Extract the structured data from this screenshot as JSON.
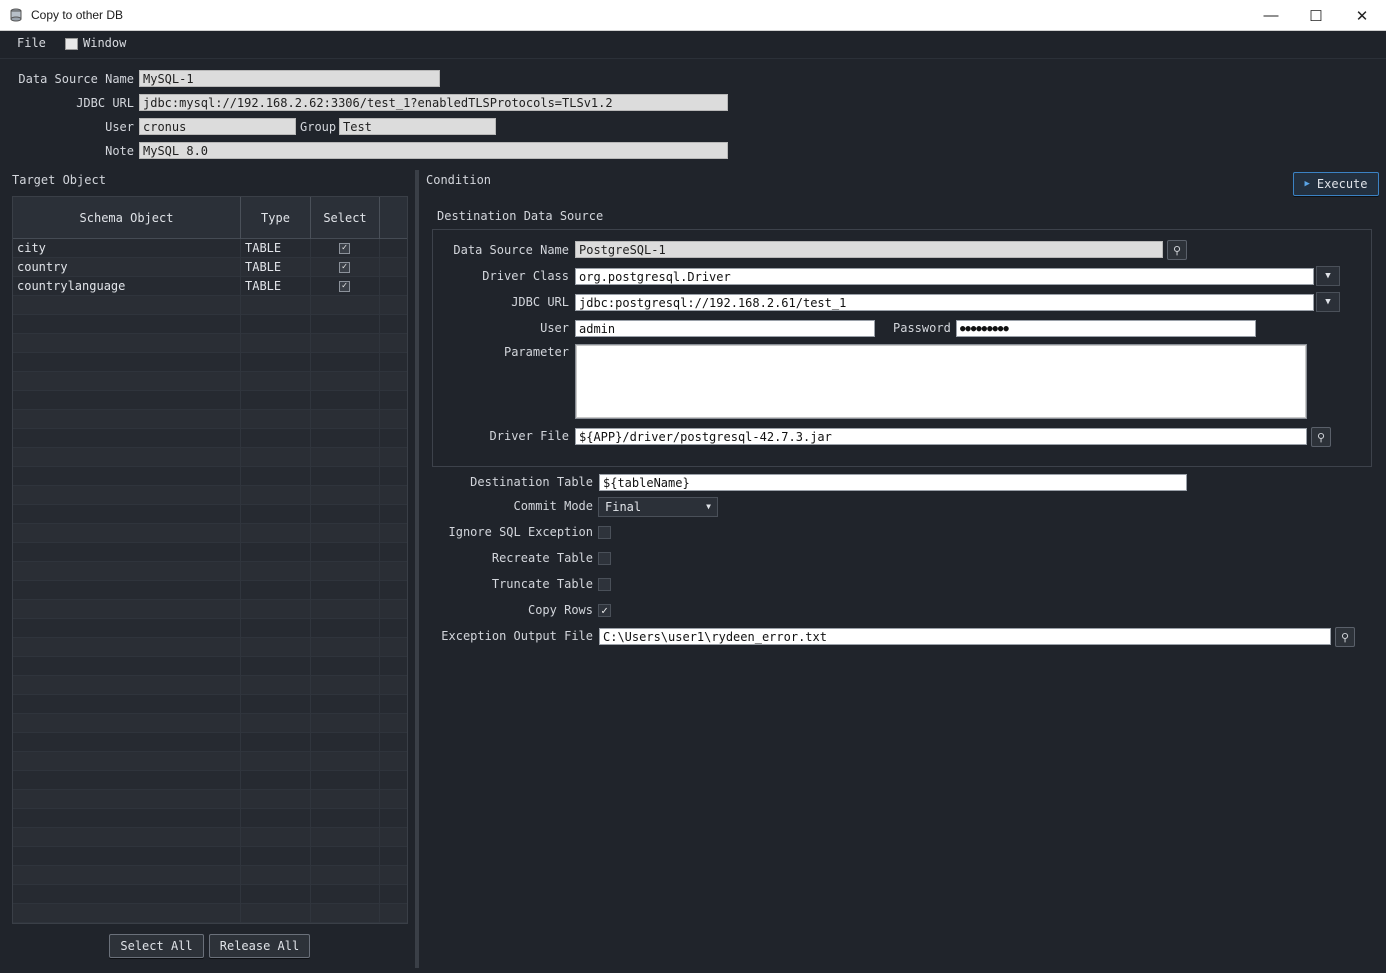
{
  "window": {
    "title": "Copy to other DB"
  },
  "menu": {
    "file": "File",
    "window": "Window"
  },
  "source": {
    "name_label": "Data Source Name",
    "name": "MySQL-1",
    "url_label": "JDBC URL",
    "url": "jdbc:mysql://192.168.2.62:3306/test_1?enabledTLSProtocols=TLSv1.2",
    "user_label": "User",
    "user": "cronus",
    "group_label": "Group",
    "group": "Test",
    "note_label": "Note",
    "note": "MySQL 8.0"
  },
  "target": {
    "title": "Target Object",
    "columns": [
      "Schema Object",
      "Type",
      "Select"
    ],
    "rows": [
      {
        "name": "city",
        "type": "TABLE",
        "selected": "✓"
      },
      {
        "name": "country",
        "type": "TABLE",
        "selected": "✓"
      },
      {
        "name": "countrylanguage",
        "type": "TABLE",
        "selected": "✓"
      }
    ],
    "select_all": "Select All",
    "release_all": "Release All"
  },
  "condition": {
    "title": "Condition",
    "execute": "Execute",
    "dest_title": "Destination Data Source",
    "dest": {
      "name_label": "Data Source Name",
      "name": "PostgreSQL-1",
      "driver_label": "Driver Class",
      "driver": "org.postgresql.Driver",
      "url_label": "JDBC URL",
      "url": "jdbc:postgresql://192.168.2.61/test_1",
      "user_label": "User",
      "user": "admin",
      "password_label": "Password",
      "password": "●●●●●●●●●",
      "param_label": "Parameter",
      "param": "",
      "driver_file_label": "Driver File",
      "driver_file": "${APP}/driver/postgresql-42.7.3.jar"
    },
    "dest_table_label": "Destination Table",
    "dest_table": "${tableName}",
    "commit_label": "Commit Mode",
    "commit": "Final",
    "ignore_label": "Ignore SQL Exception",
    "recreate_label": "Recreate Table",
    "truncate_label": "Truncate Table",
    "copyrows_label": "Copy Rows",
    "copyrows_check": "✓",
    "exception_label": "Exception Output File",
    "exception_file": "C:\\Users\\user1\\rydeen_error.txt"
  },
  "icons": {
    "search": "⚲",
    "dropdown": "▼",
    "play": "▶",
    "minimize": "—",
    "maximize": "☐",
    "close": "✕"
  }
}
